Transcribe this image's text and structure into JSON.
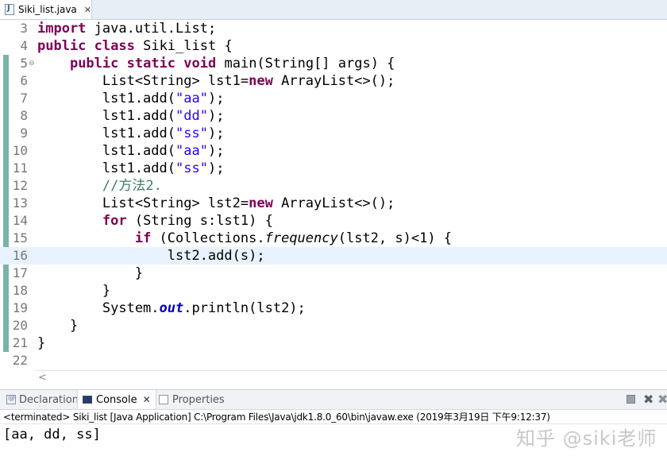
{
  "editor_tab": {
    "file_name": "Siki_list.java",
    "close": "✕",
    "icon": "java-file-icon"
  },
  "code_lines": [
    {
      "num": "3",
      "fold": "",
      "tokens": [
        {
          "c": "kw",
          "t": "import"
        },
        {
          "c": "",
          "t": " java.util.List;"
        }
      ]
    },
    {
      "num": "4",
      "fold": "",
      "tokens": [
        {
          "c": "kw",
          "t": "public"
        },
        {
          "c": "",
          "t": " "
        },
        {
          "c": "kw",
          "t": "class"
        },
        {
          "c": "",
          "t": " Siki_list {"
        }
      ]
    },
    {
      "num": "5",
      "fold": "⊖",
      "tokens": [
        {
          "c": "",
          "t": "    "
        },
        {
          "c": "kw",
          "t": "public"
        },
        {
          "c": "",
          "t": " "
        },
        {
          "c": "kw",
          "t": "static"
        },
        {
          "c": "",
          "t": " "
        },
        {
          "c": "kw",
          "t": "void"
        },
        {
          "c": "",
          "t": " main(String[] args) {"
        }
      ]
    },
    {
      "num": "6",
      "fold": "",
      "tokens": [
        {
          "c": "",
          "t": "        List<String> lst1="
        },
        {
          "c": "kw",
          "t": "new"
        },
        {
          "c": "",
          "t": " ArrayList<>();"
        }
      ]
    },
    {
      "num": "7",
      "fold": "",
      "tokens": [
        {
          "c": "",
          "t": "        lst1.add("
        },
        {
          "c": "str",
          "t": "\"aa\""
        },
        {
          "c": "",
          "t": ");"
        }
      ]
    },
    {
      "num": "8",
      "fold": "",
      "tokens": [
        {
          "c": "",
          "t": "        lst1.add("
        },
        {
          "c": "str",
          "t": "\"dd\""
        },
        {
          "c": "",
          "t": ");"
        }
      ]
    },
    {
      "num": "9",
      "fold": "",
      "tokens": [
        {
          "c": "",
          "t": "        lst1.add("
        },
        {
          "c": "str",
          "t": "\"ss\""
        },
        {
          "c": "",
          "t": ");"
        }
      ]
    },
    {
      "num": "10",
      "fold": "",
      "tokens": [
        {
          "c": "",
          "t": "        lst1.add("
        },
        {
          "c": "str",
          "t": "\"aa\""
        },
        {
          "c": "",
          "t": ");"
        }
      ]
    },
    {
      "num": "11",
      "fold": "",
      "tokens": [
        {
          "c": "",
          "t": "        lst1.add("
        },
        {
          "c": "str",
          "t": "\"ss\""
        },
        {
          "c": "",
          "t": ");"
        }
      ]
    },
    {
      "num": "12",
      "fold": "",
      "tokens": [
        {
          "c": "",
          "t": "        "
        },
        {
          "c": "cm",
          "t": "//方法2."
        }
      ]
    },
    {
      "num": "13",
      "fold": "",
      "tokens": [
        {
          "c": "",
          "t": "        List<String> lst2="
        },
        {
          "c": "kw",
          "t": "new"
        },
        {
          "c": "",
          "t": " ArrayList<>();"
        }
      ]
    },
    {
      "num": "14",
      "fold": "",
      "tokens": [
        {
          "c": "",
          "t": "        "
        },
        {
          "c": "kw",
          "t": "for"
        },
        {
          "c": "",
          "t": " (String s:lst1) {"
        }
      ]
    },
    {
      "num": "15",
      "fold": "",
      "tokens": [
        {
          "c": "",
          "t": "            "
        },
        {
          "c": "kw",
          "t": "if"
        },
        {
          "c": "",
          "t": " (Collections."
        },
        {
          "c": "it",
          "t": "frequency"
        },
        {
          "c": "",
          "t": "(lst2, s)<1) {"
        }
      ]
    },
    {
      "num": "16",
      "fold": "",
      "tokens": [
        {
          "c": "",
          "t": "                lst2.add(s);"
        }
      ]
    },
    {
      "num": "17",
      "fold": "",
      "tokens": [
        {
          "c": "",
          "t": "            }"
        }
      ]
    },
    {
      "num": "18",
      "fold": "",
      "tokens": [
        {
          "c": "",
          "t": "        }"
        }
      ]
    },
    {
      "num": "19",
      "fold": "",
      "tokens": [
        {
          "c": "",
          "t": "        System."
        },
        {
          "c": "field",
          "t": "out"
        },
        {
          "c": "",
          "t": ".println(lst2);"
        }
      ]
    },
    {
      "num": "20",
      "fold": "",
      "tokens": [
        {
          "c": "",
          "t": "    }"
        }
      ]
    },
    {
      "num": "21",
      "fold": "",
      "tokens": [
        {
          "c": "",
          "t": "}"
        }
      ]
    },
    {
      "num": "22",
      "fold": "",
      "tokens": []
    }
  ],
  "current_line": "16",
  "colors": {
    "keyword": "#7f0055",
    "string": "#2a00ff",
    "comment": "#3f7f5f",
    "current_line_bg": "#e8f2fe"
  },
  "scroll_left": "<",
  "console_view": {
    "tabs": [
      {
        "label": "Declaration",
        "icon": "declaration-icon",
        "active": false
      },
      {
        "label": "Console",
        "icon": "console-icon",
        "active": true,
        "close": "✕"
      },
      {
        "label": "Properties",
        "icon": "properties-icon",
        "active": false
      }
    ],
    "status": "<terminated> Siki_list [Java Application] C:\\Program Files\\Java\\jdk1.8.0_60\\bin\\javaw.exe (2019年3月19日 下午9:12:37)",
    "output": "[aa, dd, ss]"
  },
  "watermark": "知乎 @siki老师"
}
